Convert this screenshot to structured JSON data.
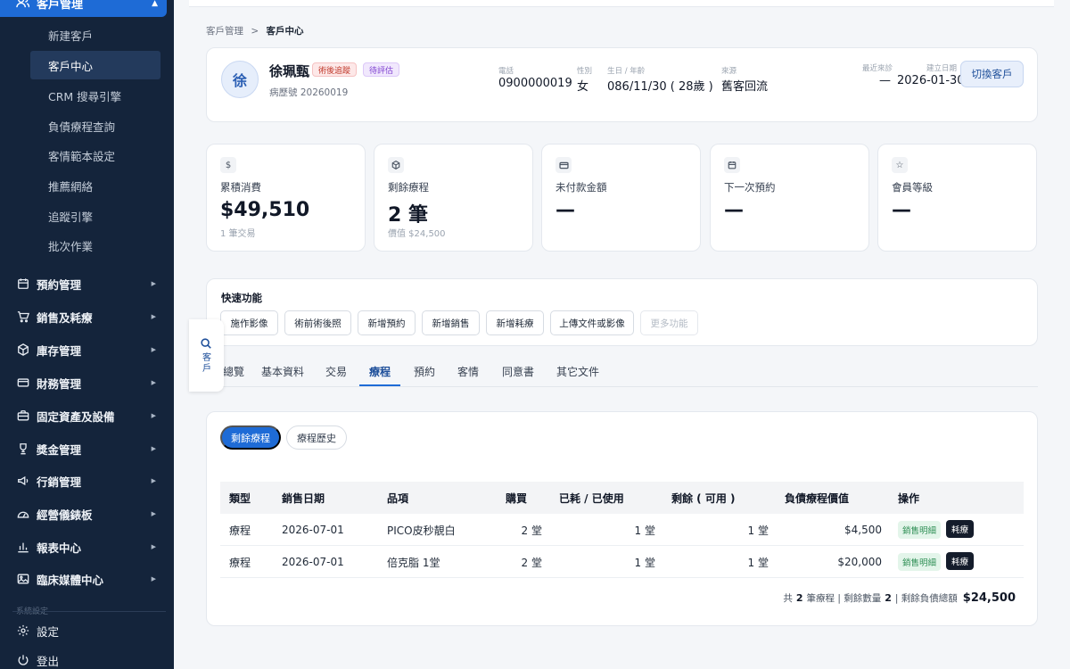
{
  "sidebar": {
    "top_group": "客戶管理",
    "sub_items": [
      "新建客戶",
      "客戶中心",
      "CRM 搜尋引擎",
      "負債療程查詢",
      "客情範本設定",
      "推薦網絡",
      "追蹤引擎",
      "批次作業"
    ],
    "groups": [
      {
        "label": "預約管理",
        "icon": "calendar-icon"
      },
      {
        "label": "銷售及耗療",
        "icon": "cart-icon"
      },
      {
        "label": "庫存管理",
        "icon": "box-icon"
      },
      {
        "label": "財務管理",
        "icon": "card-icon"
      },
      {
        "label": "固定資產及設備",
        "icon": "briefcase-icon"
      },
      {
        "label": "獎金管理",
        "icon": "trophy-icon"
      },
      {
        "label": "行銷管理",
        "icon": "megaphone-icon"
      },
      {
        "label": "經營儀錶板",
        "icon": "dashboard-icon"
      },
      {
        "label": "報表中心",
        "icon": "bar-chart-icon"
      },
      {
        "label": "臨床媒體中心",
        "icon": "image-icon"
      }
    ],
    "faded_label": "系統設定",
    "settings": "設定",
    "logout": "登出"
  },
  "breadcrumb": {
    "parent": "客戶管理",
    "sep": ">",
    "current": "客戶中心"
  },
  "patient": {
    "avatar": "徐",
    "name": "徐珮甄",
    "badge_followup": "術後追蹤",
    "badge_pending": "待評估",
    "chart_no": "病歷號 20260019",
    "phone_label": "電話",
    "phone": "0900000019",
    "gender_label": "性別",
    "gender": "女",
    "birth_label": "生日 / 年齡",
    "birth": "086/11/30 ( 28歲 )",
    "source_label": "來源",
    "source": "舊客回流",
    "last_visit_label": "最近來診",
    "last_visit": "—",
    "created_label": "建立日期",
    "created": "2026-01-30",
    "switch_button": "切換客戶"
  },
  "stats": [
    {
      "icon": "dollar-icon",
      "label": "累積消費",
      "value": "$49,510",
      "sub": "1 筆交易"
    },
    {
      "icon": "package-icon",
      "label": "剩餘療程",
      "value": "2 筆",
      "sub": "價值 $24,500"
    },
    {
      "icon": "credit-card-icon",
      "label": "未付款金額",
      "value": "—",
      "sub": ""
    },
    {
      "icon": "calendar-icon",
      "label": "下一次預約",
      "value": "—",
      "sub": ""
    },
    {
      "icon": "star-icon",
      "label": "會員等級",
      "value": "—",
      "sub": ""
    }
  ],
  "quick": {
    "title": "快速功能",
    "buttons": [
      "施作影像",
      "術前術後照",
      "新增預約",
      "新增銷售",
      "新增耗療",
      "上傳文件或影像",
      "更多功能"
    ]
  },
  "floater_label": "客戶",
  "tabs": [
    "總覽",
    "基本資料",
    "交易",
    "療程",
    "預約",
    "客情",
    "同意書",
    "其它文件"
  ],
  "active_tab": "療程",
  "subtabs": {
    "remaining": "剩餘療程",
    "history": "療程歷史"
  },
  "table": {
    "headers": [
      "類型",
      "銷售日期",
      "品項",
      "購買",
      "已耗 / 已使用",
      "剩餘 ( 可用 )",
      "負債療程價值",
      "操作"
    ],
    "rows": [
      {
        "type": "療程",
        "date": "2026-07-01",
        "item": "PICO皮秒靚白",
        "bought": "2 堂",
        "used": "1 堂",
        "remain": "1 堂",
        "value": "$4,500",
        "action1": "銷售明細",
        "action2": "耗療"
      },
      {
        "type": "療程",
        "date": "2026-07-01",
        "item": "倍克脂 1堂",
        "bought": "2 堂",
        "used": "1 堂",
        "remain": "1 堂",
        "value": "$20,000",
        "action1": "銷售明細",
        "action2": "耗療"
      }
    ],
    "footer": {
      "prefix": "共",
      "count": "2",
      "mid": "筆療程 | 剩餘數量",
      "qty": "2",
      "suffix": "| 剩餘負債總額",
      "total": "$24,500"
    }
  }
}
